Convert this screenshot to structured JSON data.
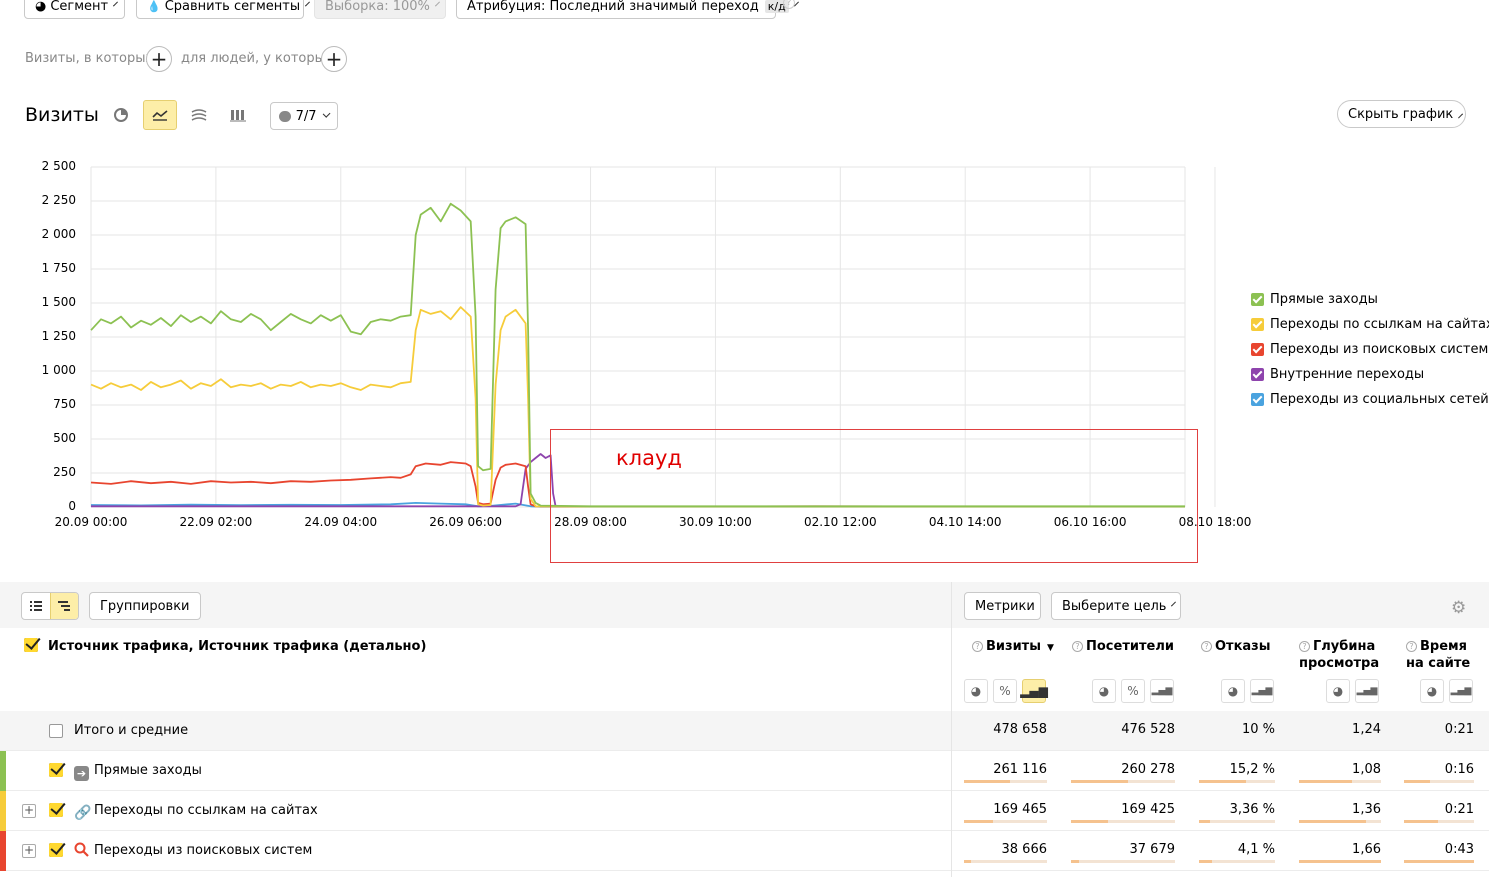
{
  "toolbar": {
    "segment_label": "Сегмент",
    "compare_label": "Сравнить сегменты",
    "sample_label": "Выборка: 100%",
    "attribution_label": "Атрибуция: Последний значимый переход",
    "attribution_badge": "к/д"
  },
  "filters": {
    "visits_where": "Визиты, в которых",
    "people_where": "для людей, у которых"
  },
  "chart_header": {
    "title": "Визиты",
    "series_count": "7/7",
    "hide_chart": "Скрыть график"
  },
  "annotation": {
    "label": "клауд",
    "color": "#e00000"
  },
  "chart_data": {
    "type": "line",
    "title": "",
    "ylim": [
      0,
      2500
    ],
    "y_ticks": [
      "0",
      "250",
      "500",
      "750",
      "1 000",
      "1 250",
      "1 500",
      "1 750",
      "2 000",
      "2 250",
      "2 500"
    ],
    "x_ticks": [
      "20.09 00:00",
      "22.09 02:00",
      "24.09 04:00",
      "26.09 06:00",
      "28.09 08:00",
      "30.09 10:00",
      "02.10 12:00",
      "04.10 14:00",
      "06.10 16:00",
      "08.10 18:00"
    ],
    "x_range_hours": [
      0,
      438
    ],
    "grid": true,
    "legend_position": "right",
    "series": [
      {
        "name": "Прямые заходы",
        "color": "#8cc152",
        "points": [
          [
            0,
            1300
          ],
          [
            4,
            1380
          ],
          [
            8,
            1350
          ],
          [
            12,
            1400
          ],
          [
            16,
            1320
          ],
          [
            20,
            1370
          ],
          [
            24,
            1340
          ],
          [
            28,
            1390
          ],
          [
            32,
            1330
          ],
          [
            36,
            1410
          ],
          [
            40,
            1360
          ],
          [
            44,
            1400
          ],
          [
            48,
            1350
          ],
          [
            52,
            1440
          ],
          [
            56,
            1380
          ],
          [
            60,
            1360
          ],
          [
            64,
            1420
          ],
          [
            68,
            1380
          ],
          [
            72,
            1300
          ],
          [
            76,
            1360
          ],
          [
            80,
            1420
          ],
          [
            84,
            1380
          ],
          [
            88,
            1350
          ],
          [
            92,
            1410
          ],
          [
            96,
            1370
          ],
          [
            100,
            1410
          ],
          [
            104,
            1290
          ],
          [
            108,
            1270
          ],
          [
            112,
            1360
          ],
          [
            116,
            1380
          ],
          [
            120,
            1370
          ],
          [
            124,
            1400
          ],
          [
            128,
            1410
          ],
          [
            130,
            2000
          ],
          [
            132,
            2150
          ],
          [
            136,
            2200
          ],
          [
            140,
            2100
          ],
          [
            144,
            2230
          ],
          [
            148,
            2180
          ],
          [
            152,
            2100
          ],
          [
            154,
            1400
          ],
          [
            155,
            300
          ],
          [
            157,
            270
          ],
          [
            160,
            280
          ],
          [
            162,
            1600
          ],
          [
            164,
            2050
          ],
          [
            166,
            2100
          ],
          [
            170,
            2130
          ],
          [
            174,
            2080
          ],
          [
            175,
            1300
          ],
          [
            176,
            100
          ],
          [
            178,
            30
          ],
          [
            180,
            10
          ],
          [
            200,
            5
          ],
          [
            250,
            5
          ],
          [
            300,
            5
          ],
          [
            350,
            5
          ],
          [
            400,
            5
          ],
          [
            438,
            5
          ]
        ]
      },
      {
        "name": "Переходы по ссылкам на сайтах",
        "color": "#f6cc3a",
        "points": [
          [
            0,
            900
          ],
          [
            4,
            870
          ],
          [
            8,
            910
          ],
          [
            12,
            880
          ],
          [
            16,
            900
          ],
          [
            20,
            860
          ],
          [
            24,
            920
          ],
          [
            28,
            880
          ],
          [
            32,
            900
          ],
          [
            36,
            930
          ],
          [
            40,
            870
          ],
          [
            44,
            910
          ],
          [
            48,
            890
          ],
          [
            52,
            940
          ],
          [
            56,
            880
          ],
          [
            60,
            900
          ],
          [
            64,
            890
          ],
          [
            68,
            910
          ],
          [
            72,
            870
          ],
          [
            76,
            900
          ],
          [
            80,
            890
          ],
          [
            84,
            920
          ],
          [
            88,
            880
          ],
          [
            92,
            900
          ],
          [
            96,
            890
          ],
          [
            100,
            910
          ],
          [
            104,
            880
          ],
          [
            108,
            860
          ],
          [
            112,
            900
          ],
          [
            116,
            890
          ],
          [
            120,
            880
          ],
          [
            124,
            910
          ],
          [
            128,
            920
          ],
          [
            130,
            1300
          ],
          [
            132,
            1450
          ],
          [
            136,
            1420
          ],
          [
            140,
            1440
          ],
          [
            144,
            1380
          ],
          [
            148,
            1470
          ],
          [
            152,
            1400
          ],
          [
            154,
            800
          ],
          [
            155,
            20
          ],
          [
            157,
            10
          ],
          [
            160,
            15
          ],
          [
            162,
            900
          ],
          [
            164,
            1300
          ],
          [
            166,
            1400
          ],
          [
            170,
            1450
          ],
          [
            174,
            1350
          ],
          [
            175,
            800
          ],
          [
            176,
            60
          ],
          [
            178,
            5
          ],
          [
            200,
            3
          ],
          [
            250,
            3
          ],
          [
            300,
            3
          ],
          [
            350,
            3
          ],
          [
            400,
            3
          ],
          [
            438,
            3
          ]
        ]
      },
      {
        "name": "Переходы из поисковых систем",
        "color": "#e8452f",
        "points": [
          [
            0,
            180
          ],
          [
            8,
            170
          ],
          [
            16,
            190
          ],
          [
            24,
            175
          ],
          [
            32,
            185
          ],
          [
            40,
            170
          ],
          [
            48,
            190
          ],
          [
            56,
            180
          ],
          [
            64,
            185
          ],
          [
            72,
            175
          ],
          [
            80,
            190
          ],
          [
            88,
            185
          ],
          [
            96,
            195
          ],
          [
            104,
            200
          ],
          [
            112,
            210
          ],
          [
            120,
            220
          ],
          [
            124,
            215
          ],
          [
            128,
            240
          ],
          [
            130,
            300
          ],
          [
            134,
            320
          ],
          [
            140,
            310
          ],
          [
            144,
            330
          ],
          [
            150,
            320
          ],
          [
            152,
            300
          ],
          [
            154,
            150
          ],
          [
            155,
            30
          ],
          [
            157,
            20
          ],
          [
            160,
            25
          ],
          [
            162,
            200
          ],
          [
            164,
            290
          ],
          [
            166,
            310
          ],
          [
            170,
            320
          ],
          [
            174,
            300
          ],
          [
            175,
            150
          ],
          [
            176,
            20
          ],
          [
            178,
            5
          ],
          [
            200,
            3
          ],
          [
            250,
            3
          ],
          [
            290,
            5
          ],
          [
            350,
            3
          ],
          [
            400,
            3
          ],
          [
            438,
            3
          ]
        ]
      },
      {
        "name": "Внутренние переходы",
        "color": "#8e44ad",
        "points": [
          [
            0,
            5
          ],
          [
            100,
            5
          ],
          [
            170,
            5
          ],
          [
            172,
            20
          ],
          [
            174,
            280
          ],
          [
            176,
            330
          ],
          [
            178,
            360
          ],
          [
            180,
            390
          ],
          [
            182,
            360
          ],
          [
            184,
            380
          ],
          [
            185,
            100
          ],
          [
            186,
            5
          ],
          [
            200,
            3
          ],
          [
            438,
            3
          ]
        ]
      },
      {
        "name": "Переходы из социальных сетей",
        "color": "#4aa3df",
        "points": [
          [
            0,
            15
          ],
          [
            20,
            12
          ],
          [
            40,
            18
          ],
          [
            60,
            14
          ],
          [
            80,
            16
          ],
          [
            100,
            15
          ],
          [
            120,
            20
          ],
          [
            130,
            30
          ],
          [
            140,
            25
          ],
          [
            150,
            20
          ],
          [
            155,
            5
          ],
          [
            160,
            8
          ],
          [
            170,
            25
          ],
          [
            176,
            5
          ],
          [
            180,
            2
          ],
          [
            438,
            2
          ]
        ]
      }
    ]
  },
  "table_controls": {
    "groupings": "Группировки",
    "metrics": "Метрики",
    "select_goal": "Выберите цель"
  },
  "table": {
    "dimension_header": "Источник трафика, Источник трафика (детально)",
    "columns": [
      "Визиты",
      "Посетители",
      "Отказы",
      "Глубина просмотра",
      "Время на сайте"
    ],
    "col_visits": "Визиты",
    "col_visitors": "Посетители",
    "col_bounce": "Отказы",
    "col_depth_1": "Глубина",
    "col_depth_2": "просмотра",
    "col_time_1": "Время",
    "col_time_2": "на сайте",
    "total": {
      "label": "Итого и средние",
      "visits": "478 658",
      "visitors": "476 528",
      "bounce": "10 %",
      "depth": "1,24",
      "time": "0:21"
    },
    "rows": [
      {
        "label": "Прямые заходы",
        "color": "#8cc152",
        "visits": "261 116",
        "visitors": "260 278",
        "bounce": "15,2 %",
        "depth": "1,08",
        "time": "0:16",
        "share": {
          "visits": 0.55,
          "visitors": 0.55,
          "bounce": 0.62,
          "depth": 0.65,
          "time": 0.37
        }
      },
      {
        "label": "Переходы по ссылкам на сайтах",
        "color": "#f6cc3a",
        "visits": "169 465",
        "visitors": "169 425",
        "bounce": "3,36 %",
        "depth": "1,36",
        "time": "0:21",
        "share": {
          "visits": 0.35,
          "visitors": 0.36,
          "bounce": 0.14,
          "depth": 0.82,
          "time": 0.49
        }
      },
      {
        "label": "Переходы из поисковых систем",
        "color": "#e8452f",
        "visits": "38 666",
        "visitors": "37 679",
        "bounce": "4,1 %",
        "depth": "1,66",
        "time": "0:43",
        "share": {
          "visits": 0.08,
          "visitors": 0.08,
          "bounce": 0.17,
          "depth": 1.0,
          "time": 1.0
        }
      }
    ]
  }
}
